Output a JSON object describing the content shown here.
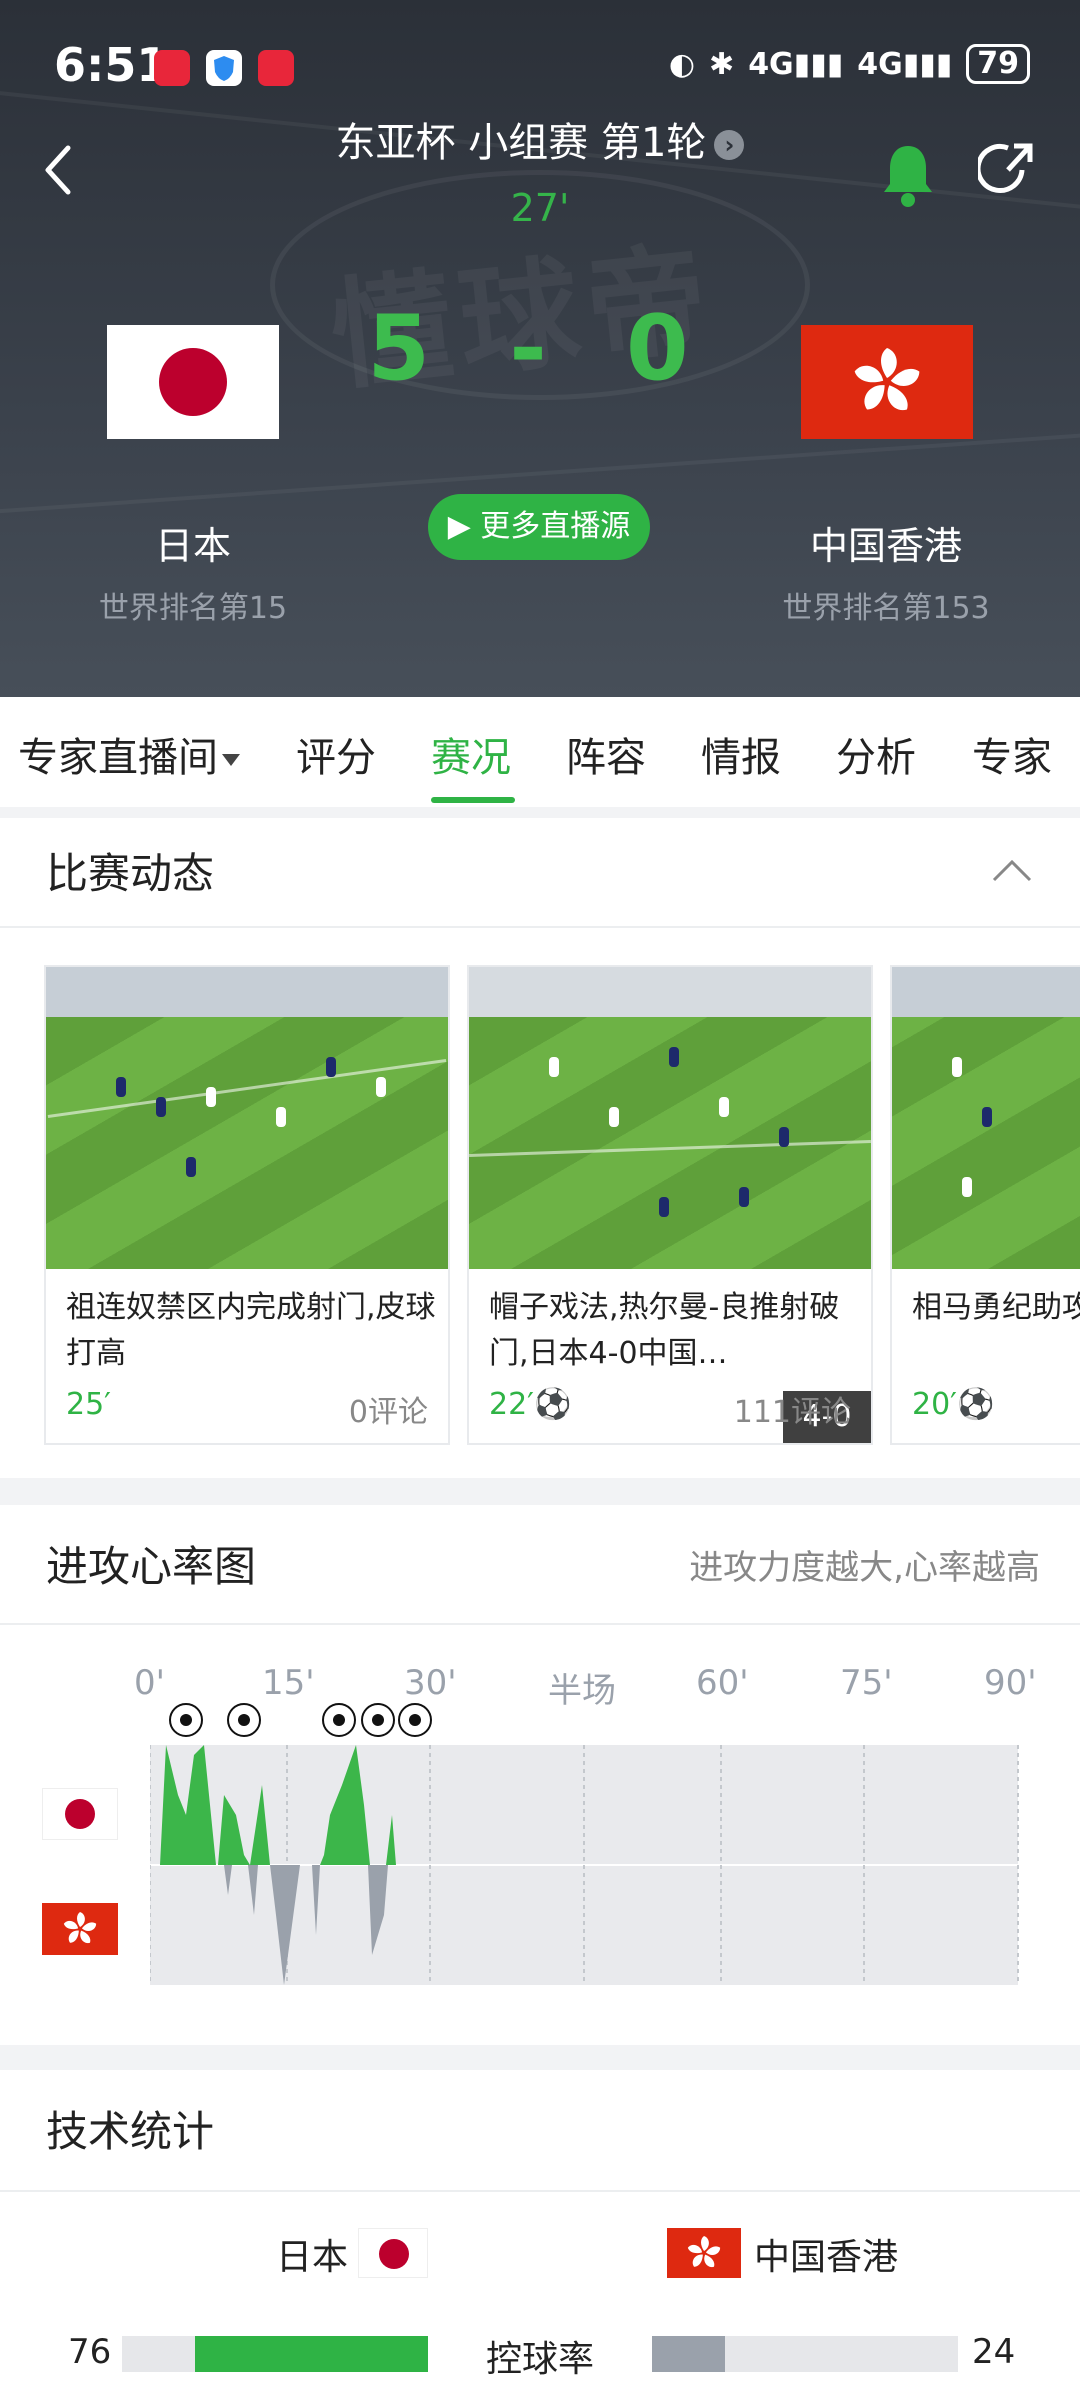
{
  "status_bar": {
    "time": "6:51",
    "battery": "79"
  },
  "header": {
    "competition": "东亚杯 小组赛 第1轮",
    "match_minute": "27'",
    "score_home": "5",
    "score_sep": "-",
    "score_away": "0",
    "more_live": "▶ 更多直播源",
    "home": {
      "name": "日本",
      "rank": "世界排名第15"
    },
    "away": {
      "name": "中国香港",
      "rank": "世界排名第153"
    },
    "accent": "#2fb345"
  },
  "tabs": [
    "专家直播间",
    "评分",
    "赛况",
    "阵容",
    "情报",
    "分析",
    "专家"
  ],
  "active_tab": "赛况",
  "match_feed": {
    "title": "比赛动态",
    "videos": [
      {
        "caption": "祖连奴禁区内完成射门,皮球打高",
        "minute": "25′",
        "comments": "0评论",
        "badge": ""
      },
      {
        "caption": "帽子戏法,热尔曼-良推射破门,日本4-0中国…",
        "minute": "22′⚽",
        "comments": "111评论",
        "badge": "4-0"
      },
      {
        "caption": "相马勇纪助攻射破门,日本",
        "minute": "20′⚽",
        "comments": "",
        "badge": ""
      }
    ]
  },
  "heart_rate": {
    "title": "进攻心率图",
    "subtitle": "进攻力度越大,心率越高",
    "axis": [
      "0'",
      "15'",
      "30'",
      "半场",
      "60'",
      "75'",
      "90'"
    ],
    "home_color": "#3cb64a",
    "away_color": "#9aa1ab",
    "goal_minutes": [
      4,
      10,
      21,
      25,
      29
    ]
  },
  "stats": {
    "title": "技术统计",
    "home_name": "日本",
    "away_name": "中国香港",
    "rows": [
      {
        "label": "控球率",
        "home": "76",
        "away": "24",
        "home_pct": 0.76,
        "away_pct": 0.24
      }
    ]
  }
}
